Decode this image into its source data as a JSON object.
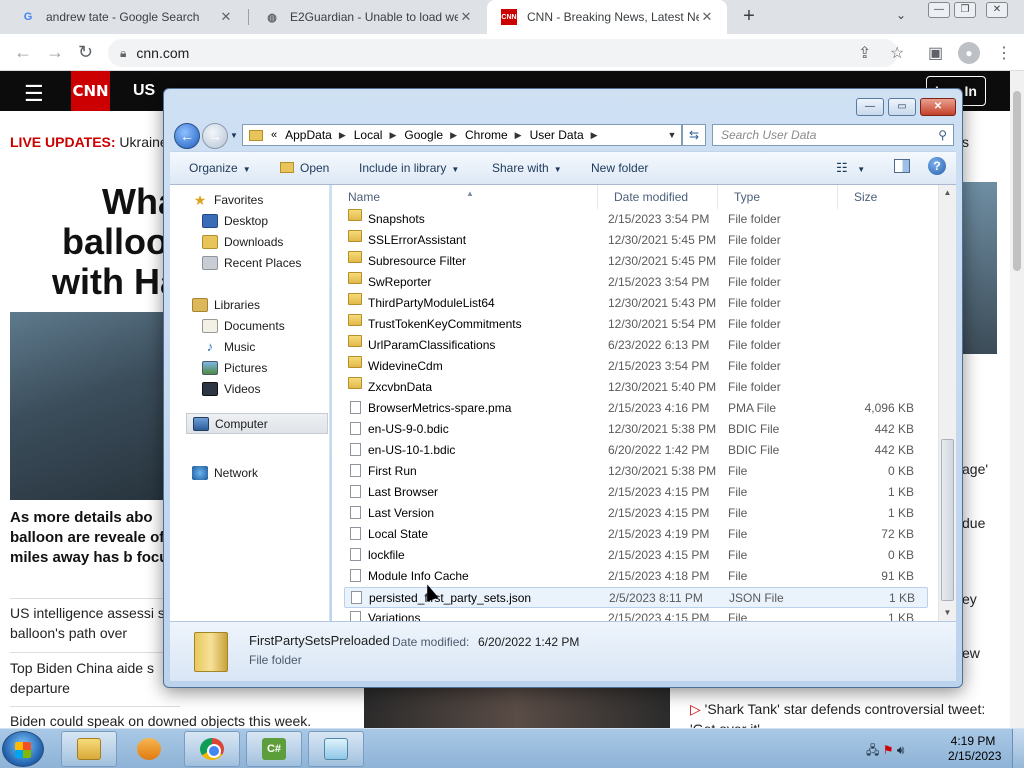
{
  "browser": {
    "tabs": [
      {
        "title": "andrew tate - Google Search",
        "favicon": "google-icon"
      },
      {
        "title": "E2Guardian - Unable to load web",
        "favicon": "globe-icon"
      },
      {
        "title": "CNN - Breaking News, Latest News",
        "favicon": "cnn-icon"
      }
    ],
    "url": "cnn.com"
  },
  "cnn": {
    "logo": "CNN",
    "nav_us": "US",
    "login": "Log In",
    "live_label": "LIVE UPDATES:",
    "live_text": "Ukraine",
    "headline": "What balloon with Hai",
    "story": "As more details abo balloon are reveale of miles away has b focus",
    "sub1": "US intelligence assessi spy balloon's path over",
    "sub2": "Top Biden China aide s departure",
    "sub3": "Biden could speak on downed objects this week.",
    "right_frag1": "s",
    "right_frag2": "age'",
    "right_frag3": "due",
    "right_frag4": "ey",
    "right_frag5": "ew",
    "shark": "'Shark Tank' star defends controversial tweet: 'Get over it'"
  },
  "explorer": {
    "address": [
      "AppData",
      "Local",
      "Google",
      "Chrome",
      "User Data"
    ],
    "search_placeholder": "Search User Data",
    "commands": {
      "organize": "Organize",
      "open": "Open",
      "include": "Include in library",
      "share": "Share with",
      "new_folder": "New folder"
    },
    "nav": {
      "favorites": "Favorites",
      "desktop": "Desktop",
      "downloads": "Downloads",
      "recent": "Recent Places",
      "libraries": "Libraries",
      "documents": "Documents",
      "music": "Music",
      "pictures": "Pictures",
      "videos": "Videos",
      "computer": "Computer",
      "network": "Network"
    },
    "columns": {
      "name": "Name",
      "date": "Date modified",
      "type": "Type",
      "size": "Size"
    },
    "files": [
      {
        "name": "Snapshots",
        "date": "2/15/2023 3:54 PM",
        "type": "File folder",
        "size": "",
        "kind": "folder"
      },
      {
        "name": "SSLErrorAssistant",
        "date": "12/30/2021 5:45 PM",
        "type": "File folder",
        "size": "",
        "kind": "folder"
      },
      {
        "name": "Subresource Filter",
        "date": "12/30/2021 5:45 PM",
        "type": "File folder",
        "size": "",
        "kind": "folder"
      },
      {
        "name": "SwReporter",
        "date": "2/15/2023 3:54 PM",
        "type": "File folder",
        "size": "",
        "kind": "folder"
      },
      {
        "name": "ThirdPartyModuleList64",
        "date": "12/30/2021 5:43 PM",
        "type": "File folder",
        "size": "",
        "kind": "folder"
      },
      {
        "name": "TrustTokenKeyCommitments",
        "date": "12/30/2021 5:54 PM",
        "type": "File folder",
        "size": "",
        "kind": "folder"
      },
      {
        "name": "UrlParamClassifications",
        "date": "6/23/2022 6:13 PM",
        "type": "File folder",
        "size": "",
        "kind": "folder"
      },
      {
        "name": "WidevineCdm",
        "date": "2/15/2023 3:54 PM",
        "type": "File folder",
        "size": "",
        "kind": "folder"
      },
      {
        "name": "ZxcvbnData",
        "date": "12/30/2021 5:40 PM",
        "type": "File folder",
        "size": "",
        "kind": "folder"
      },
      {
        "name": "BrowserMetrics-spare.pma",
        "date": "2/15/2023 4:16 PM",
        "type": "PMA File",
        "size": "4,096 KB",
        "kind": "file"
      },
      {
        "name": "en-US-9-0.bdic",
        "date": "12/30/2021 5:38 PM",
        "type": "BDIC File",
        "size": "442 KB",
        "kind": "file"
      },
      {
        "name": "en-US-10-1.bdic",
        "date": "6/20/2022 1:42 PM",
        "type": "BDIC File",
        "size": "442 KB",
        "kind": "file"
      },
      {
        "name": "First Run",
        "date": "12/30/2021 5:38 PM",
        "type": "File",
        "size": "0 KB",
        "kind": "file"
      },
      {
        "name": "Last Browser",
        "date": "2/15/2023 4:15 PM",
        "type": "File",
        "size": "1 KB",
        "kind": "file"
      },
      {
        "name": "Last Version",
        "date": "2/15/2023 4:15 PM",
        "type": "File",
        "size": "1 KB",
        "kind": "file"
      },
      {
        "name": "Local State",
        "date": "2/15/2023 4:19 PM",
        "type": "File",
        "size": "72 KB",
        "kind": "file"
      },
      {
        "name": "lockfile",
        "date": "2/15/2023 4:15 PM",
        "type": "File",
        "size": "0 KB",
        "kind": "file"
      },
      {
        "name": "Module Info Cache",
        "date": "2/15/2023 4:18 PM",
        "type": "File",
        "size": "91 KB",
        "kind": "file"
      },
      {
        "name": "persisted_first_party_sets.json",
        "date": "2/5/2023 8:11 PM",
        "type": "JSON File",
        "size": "1 KB",
        "kind": "file"
      },
      {
        "name": "Variations",
        "date": "2/15/2023 4:15 PM",
        "type": "File",
        "size": "1 KB",
        "kind": "file"
      }
    ],
    "details": {
      "name": "FirstPartySetsPreloaded",
      "date_label": "Date modified:",
      "date_value": "6/20/2022 1:42 PM",
      "type": "File folder"
    }
  },
  "taskbar": {
    "apps": [
      "windows-explorer-icon",
      "media-player-icon",
      "chrome-icon",
      "csharp-icon",
      "notepad-icon"
    ],
    "csharp_label": "C#",
    "time": "4:19 PM",
    "date": "2/15/2023"
  }
}
